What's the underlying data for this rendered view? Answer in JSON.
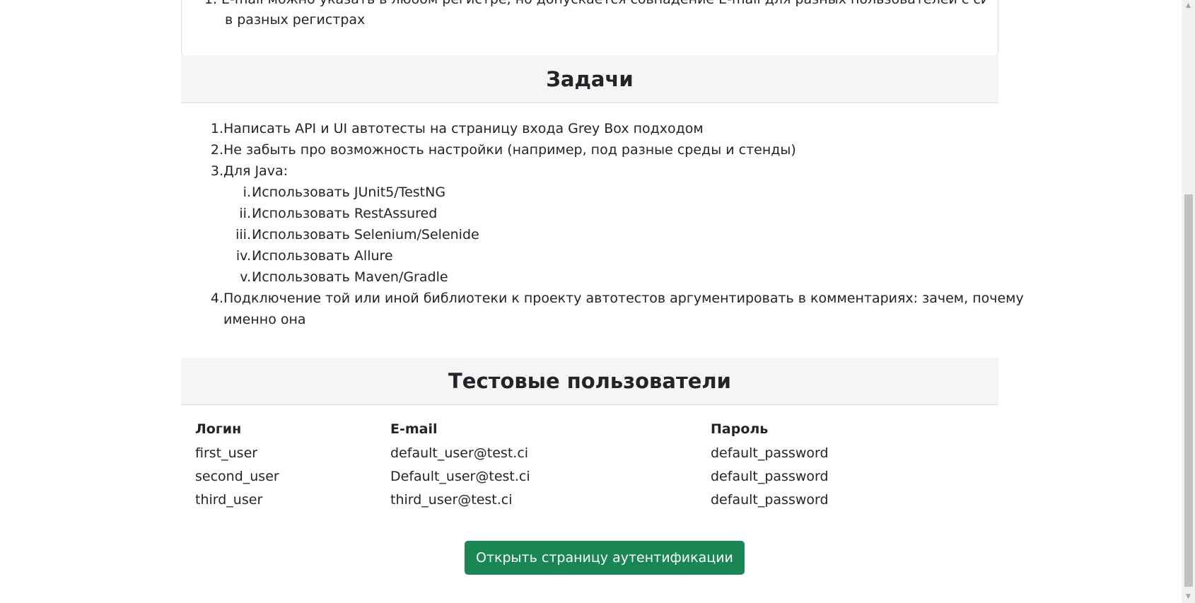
{
  "rules_card": {
    "item_number": "1.",
    "item_text": "E-mail можно указать в любом регистре, но допускается совпадение E-mail для разных пользователей с символами",
    "item_continuation": "в разных регистрах"
  },
  "tasks_section": {
    "title": "Задачи",
    "items": [
      {
        "num": "1.",
        "text": "Написать API и UI автотесты на страницу входа Grey Box подходом"
      },
      {
        "num": "2.",
        "text": "Не забыть про возможность настройки (например, под разные среды и стенды)"
      },
      {
        "num": "3.",
        "text": "Для Java:"
      }
    ],
    "java_items": [
      {
        "num": "i.",
        "text": "Использовать JUnit5/TestNG"
      },
      {
        "num": "ii.",
        "text": "Использовать RestAssured"
      },
      {
        "num": "iii.",
        "text": "Использовать Selenium/Selenide"
      },
      {
        "num": "iv.",
        "text": "Использовать Allure"
      },
      {
        "num": "v.",
        "text": "Использовать Maven/Gradle"
      }
    ],
    "item4": {
      "num": "4.",
      "text": "Подключение той или иной библиотеки к проекту автотестов аргументировать в комментариях: зачем, почему",
      "continuation": "именно она"
    }
  },
  "users_section": {
    "title": "Тестовые пользователи",
    "columns": [
      "Логин",
      "E-mail",
      "Пароль"
    ],
    "rows": [
      [
        "first_user",
        "default_user@test.ci",
        "default_password"
      ],
      [
        "second_user",
        "Default_user@test.ci",
        "default_password"
      ],
      [
        "third_user",
        "third_user@test.ci",
        "default_password"
      ]
    ]
  },
  "actions": {
    "open_auth_label": "Открыть страницу аутентификации"
  },
  "colors": {
    "button_bg": "#198754",
    "section_header_bg": "#f5f5f5",
    "text": "#212529"
  }
}
